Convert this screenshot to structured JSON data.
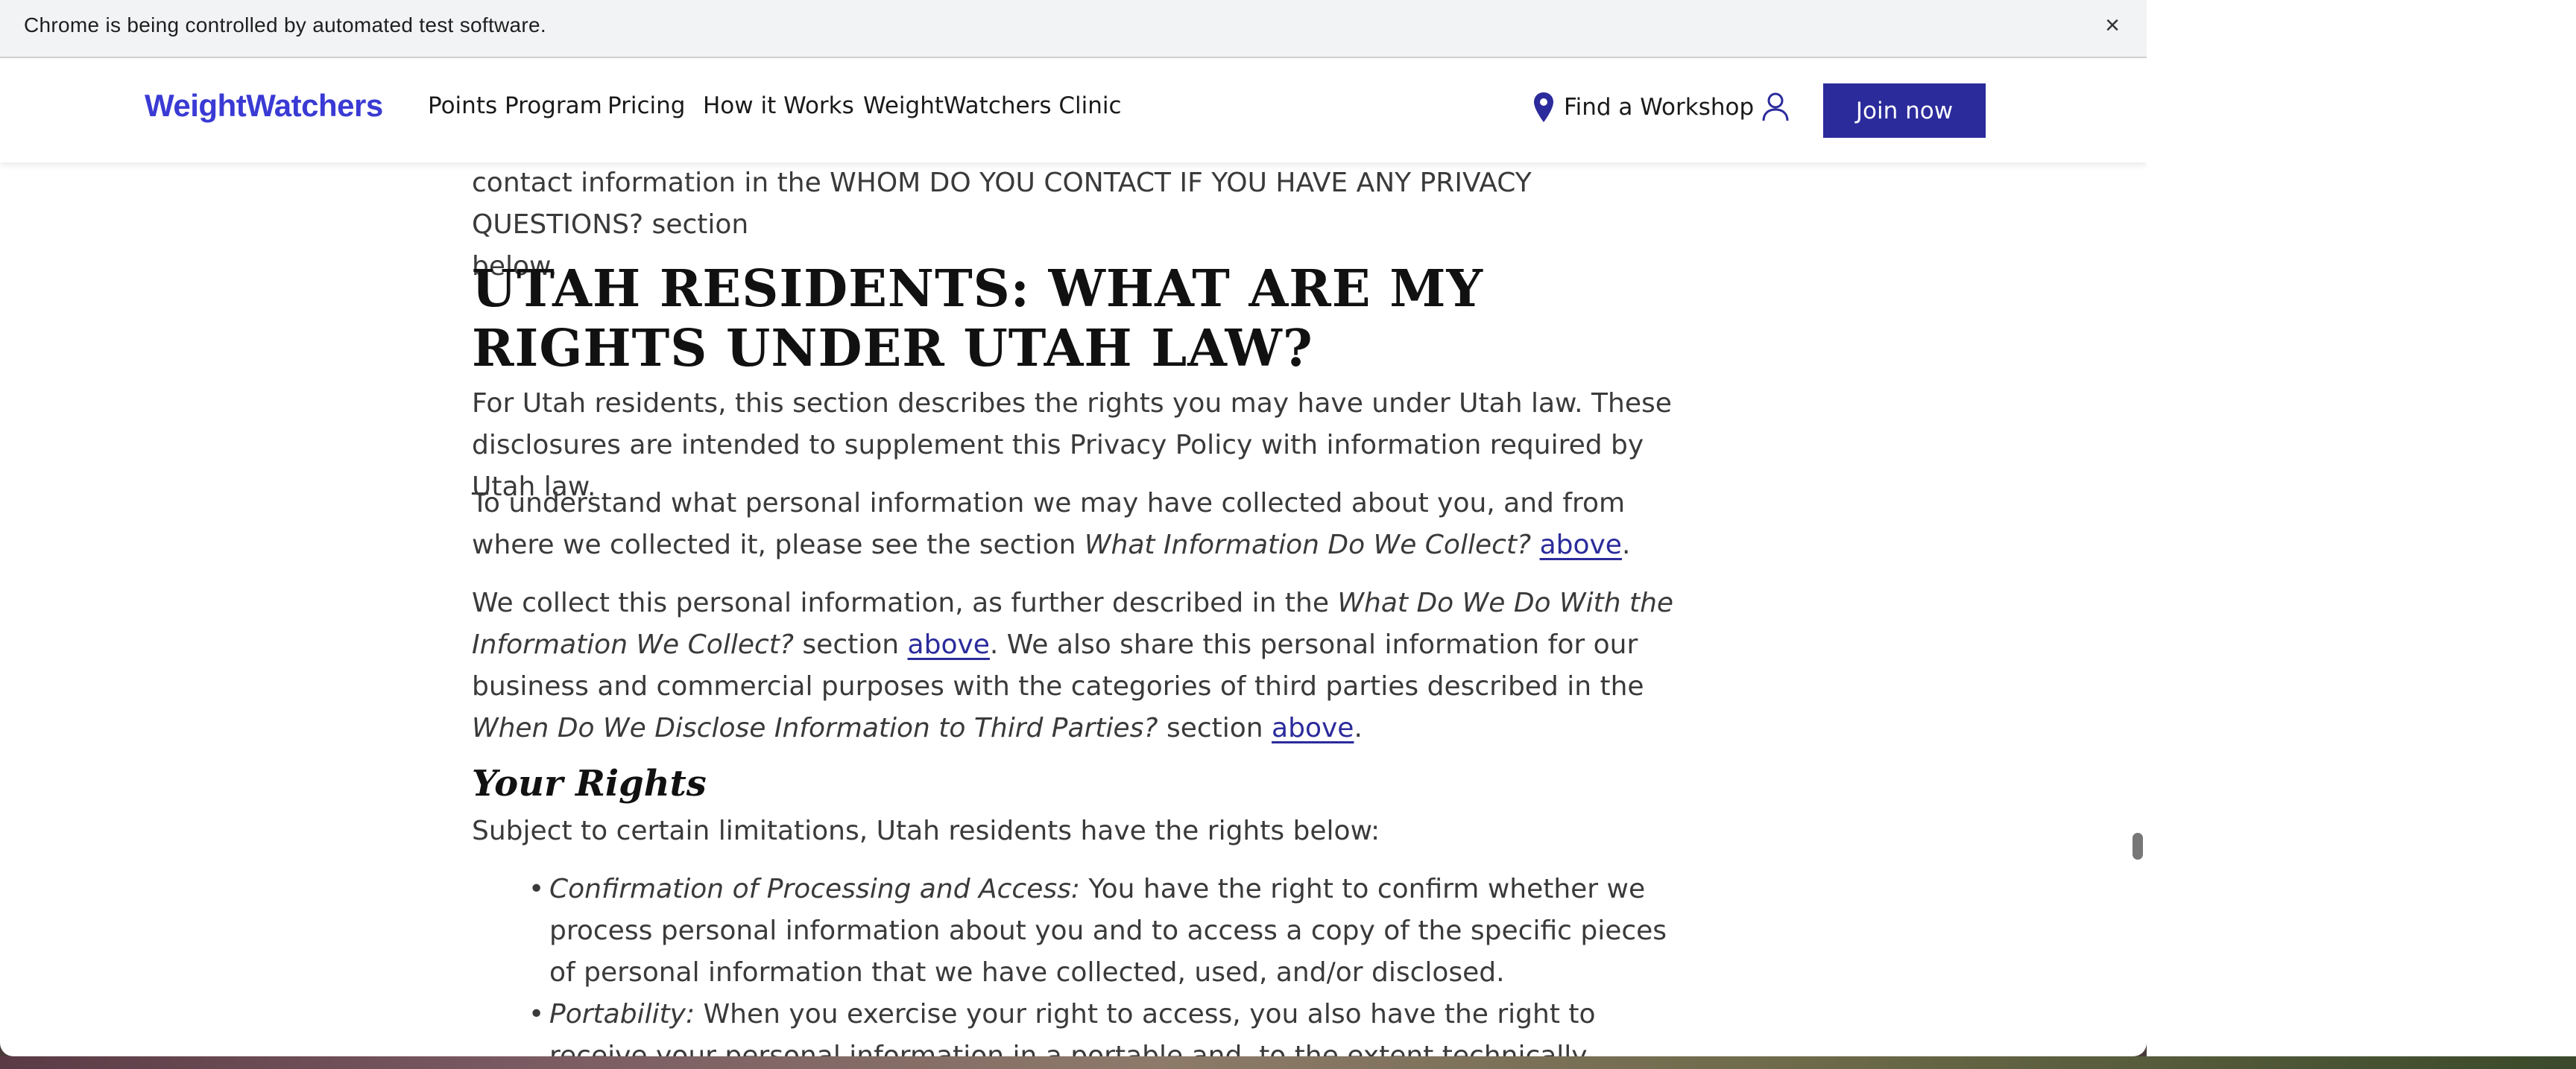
{
  "infobar": {
    "message": "Chrome is being controlled by automated test software.",
    "close_glyph": "×"
  },
  "header": {
    "logo": "WeightWatchers",
    "nav": {
      "points": "Points Program",
      "pricing": "Pricing",
      "how": "How it Works",
      "clinic": "WeightWatchers Clinic"
    },
    "find_workshop": "Find a Workshop",
    "join_now": "Join now",
    "icons": [
      "location-pin-icon",
      "account-icon"
    ],
    "colors": {
      "brand": "#3a3ad4",
      "button": "#2b2b9c"
    }
  },
  "content": {
    "para0_line1": "contact information in the WHOM DO YOU CONTACT IF YOU HAVE ANY PRIVACY QUESTIONS? section",
    "para0_line2": "below.",
    "heading": "UTAH RESIDENTS: WHAT ARE MY RIGHTS UNDER UTAH LAW?",
    "para1": "For Utah residents, this section describes the rights you may have under Utah law. These disclosures are intended to supplement this Privacy Policy with information required by Utah law.",
    "para2": {
      "text": "To understand what personal information we may have collected about you, and from where we collected it, please see the section ",
      "em": "What Information Do We Collect?",
      "link": "above",
      "end": "."
    },
    "para3": {
      "t1": "We collect this personal information, as further described in the ",
      "em1": "What Do We Do With the Information We Collect?",
      "t2": " section ",
      "link1": "above",
      "t3": ". We also share this personal information for our business and commercial purposes with the categories of third parties described in the ",
      "em2": "When Do We Disclose Information to Third Parties?",
      "t4": " section ",
      "link2": "above",
      "end": "."
    },
    "subheading": "Your Rights",
    "para4": "Subject to certain limitations, Utah residents have the rights below:",
    "bullets": [
      {
        "em": "Confirmation of Processing and Access:",
        "text": " You have the right to confirm whether we process personal information about you and to access a copy of the specific pieces of personal information that we have collected, used, and/or disclosed."
      },
      {
        "em": "Portability:",
        "text": " When you exercise your right to access, you also have the right to receive your personal information in a portable and, to the extent technically feasible, readily usable format."
      }
    ]
  }
}
